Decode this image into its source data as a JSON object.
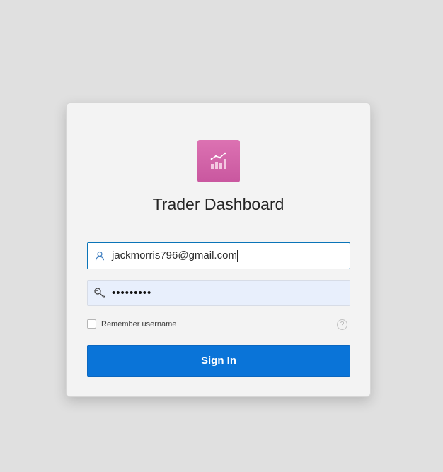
{
  "app": {
    "title": "Trader Dashboard",
    "logo_icon": "chart-growth-icon",
    "accent_color": "#d466aa"
  },
  "form": {
    "username_value": "jackmorris796@gmail.com",
    "username_icon": "user-icon",
    "password_masked": "•••••••••",
    "password_icon": "key-icon",
    "remember_label": "Remember username",
    "remember_checked": false,
    "help_glyph": "?",
    "help_icon": "help-circle-icon",
    "signin_label": "Sign In",
    "signin_color": "#0a74d8"
  }
}
